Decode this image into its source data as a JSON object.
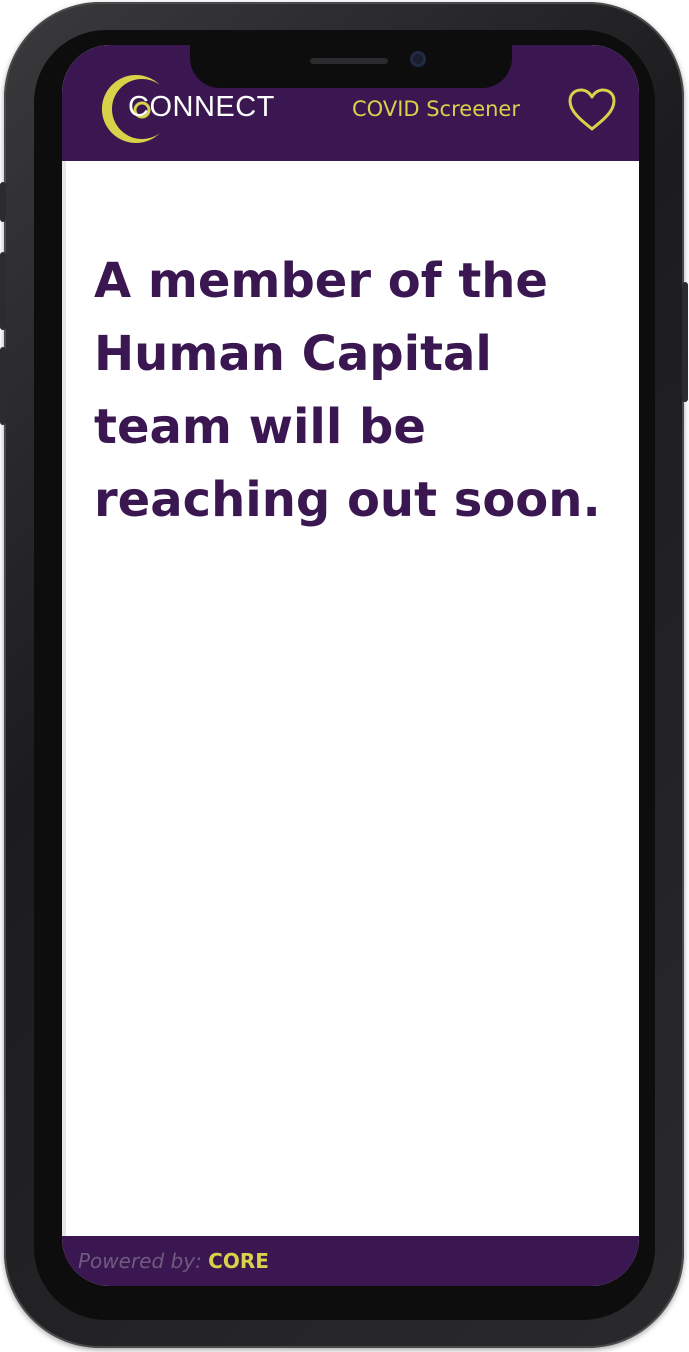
{
  "header": {
    "logo_text": "CONNECT",
    "title": "COVID Screener",
    "favorite_icon": "heart-icon"
  },
  "main": {
    "message": "A member of the Human Capital team will be reaching out soon."
  },
  "footer": {
    "powered_label": "Powered by:",
    "powered_brand": "CORE"
  },
  "colors": {
    "brand_purple": "#3b1751",
    "accent_yellow": "#d8d14a",
    "background": "#ffffff"
  }
}
